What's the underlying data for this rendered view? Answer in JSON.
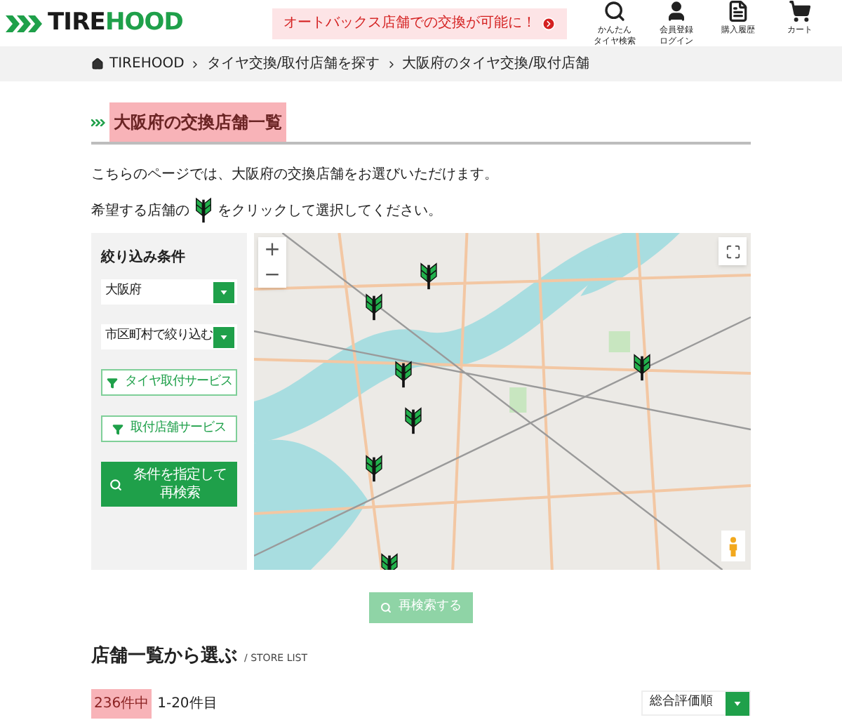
{
  "header": {
    "logo": {
      "part_1": "TIRE",
      "part_2": "HOOD"
    },
    "notice": "オートバックス店舗での交換が可能に！",
    "nav": [
      {
        "kind": "search",
        "label": [
          "かんたん",
          "タイヤ検索"
        ]
      },
      {
        "kind": "user",
        "label": [
          "会員登録",
          "ログイン"
        ]
      },
      {
        "kind": "history",
        "label": [
          "購入履歴"
        ]
      },
      {
        "kind": "cart",
        "label": [
          "カート"
        ]
      }
    ]
  },
  "breadcrumb": [
    "TIREHOOD",
    "タイヤ交換/取付店舗を探す",
    "大阪府のタイヤ交換/取付店舗"
  ],
  "page_title": "大阪府の交換店舗一覧",
  "intro": "こちらのページでは、大阪府の交換店舗をお選びいただけます。",
  "instruction": {
    "before": "希望する店舗の",
    "after": "をクリックして選択してください。"
  },
  "filters": {
    "title": "絞り込み条件",
    "selects": [
      {
        "value": "大阪府"
      },
      {
        "value": "市区町村で絞り込む"
      }
    ],
    "service_buttons": [
      "タイヤ取付サービス",
      "取付店舗サービス"
    ],
    "search_button": "条件を指定して再検索"
  },
  "map": {
    "zoom_in": "+",
    "zoom_out": "−"
  },
  "research_button": {
    "label": "再検索する",
    "disabled": true
  },
  "store_list": {
    "title": "店舗一覧から選ぶ",
    "subtitle": "/ STORE LIST",
    "count": "236件中",
    "range": "1-20件目",
    "sort": "総合評価順"
  }
}
